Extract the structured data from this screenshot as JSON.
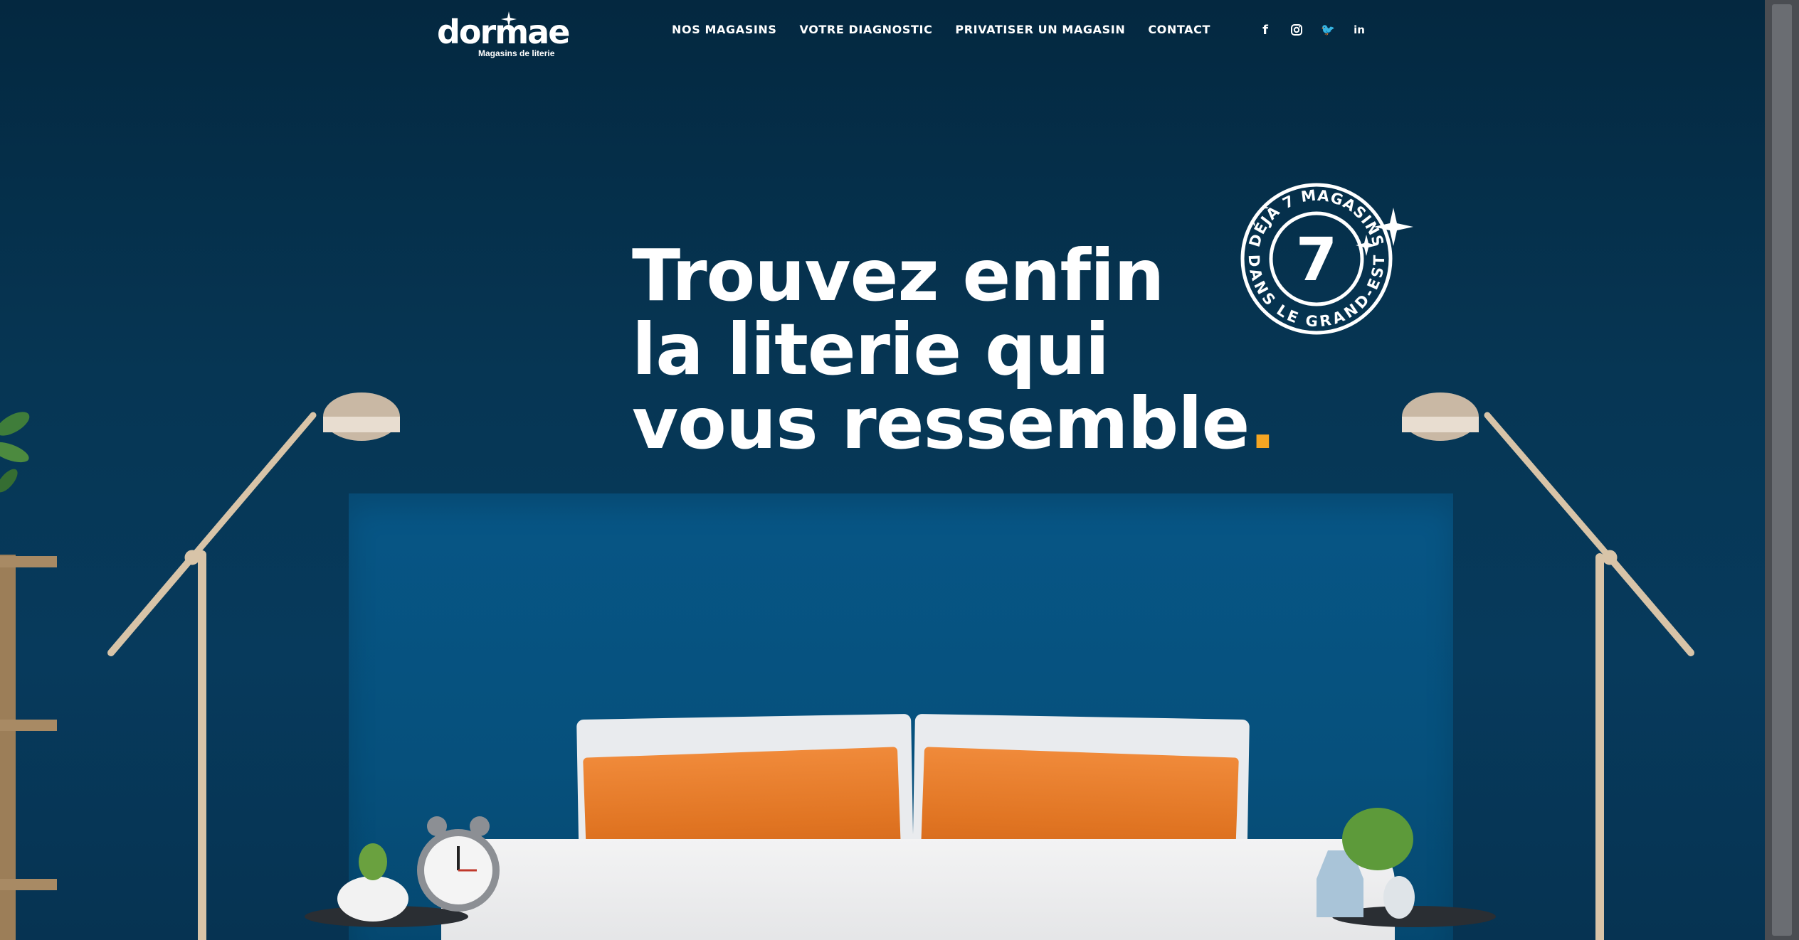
{
  "logo": {
    "wordmark": "dormae",
    "tagline": "Magasins de literie"
  },
  "nav": {
    "items": [
      "NOS MAGASINS",
      "VOTRE DIAGNOSTIC",
      "PRIVATISER UN MAGASIN",
      "CONTACT"
    ]
  },
  "social": [
    "facebook",
    "instagram",
    "twitter",
    "linkedin"
  ],
  "social_glyphs": {
    "facebook": "f",
    "twitter": "🐦",
    "linkedin": "in"
  },
  "hero": {
    "line1": "Trouvez enfin",
    "line2": "la literie qui",
    "line3": "vous ressemble",
    "accent_dot": ".",
    "accent_color": "#f5a623"
  },
  "badge": {
    "number": "7",
    "top_text": "DÉJÀ 7 MAGASINS",
    "bottom_text": "DANS LE GRAND-EST"
  },
  "colors": {
    "wall": "#063654",
    "headboard": "#075686",
    "pillow": "#e07422",
    "text": "#ffffff"
  }
}
